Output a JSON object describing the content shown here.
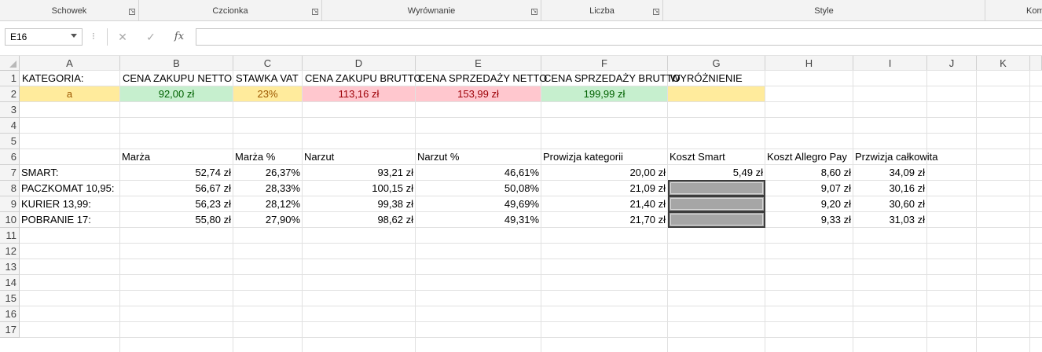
{
  "ribbon": {
    "groups": [
      "Schowek",
      "Czcionka",
      "Wyrównanie",
      "Liczba",
      "Style",
      "Kom"
    ]
  },
  "formula_bar": {
    "name_box": "E16",
    "dots": "⁝",
    "cancel": "✕",
    "enter": "✓",
    "fx": "fx",
    "formula": ""
  },
  "columns": [
    "A",
    "B",
    "C",
    "D",
    "E",
    "F",
    "G",
    "H",
    "I",
    "J",
    "K"
  ],
  "rows": [
    "1",
    "2",
    "3",
    "4",
    "5",
    "6",
    "7",
    "8",
    "9",
    "10",
    "11",
    "12",
    "13",
    "14",
    "15",
    "16",
    "17"
  ],
  "cells": {
    "A1": "KATEGORIA:",
    "B1": "CENA ZAKUPU NETTO",
    "C1": "STAWKA VAT",
    "D1": "CENA ZAKUPU BRUTTO",
    "E1": "CENA SPRZEDAŻY NETTO",
    "F1": "CENA SPRZEDAŻY BRUTTO",
    "G1": "WYRÓŻNIENIE",
    "A2": "a",
    "B2": "92,00 zł",
    "C2": "23%",
    "D2": "113,16 zł",
    "E2": "153,99 zł",
    "F2": "199,99 zł",
    "G2": "",
    "B6": "Marża",
    "C6": "Marża %",
    "D6": "Narzut",
    "E6": "Narzut %",
    "F6": "Prowizja kategorii",
    "G6": "Koszt Smart",
    "H6": "Koszt Allegro Pay",
    "I6": "Przwizja całkowita",
    "A7": "SMART:",
    "B7": "52,74 zł",
    "C7": "26,37%",
    "D7": "93,21 zł",
    "E7": "46,61%",
    "F7": "20,00 zł",
    "G7": "5,49 zł",
    "H7": "8,60 zł",
    "I7": "34,09 zł",
    "A8": "PACZKOMAT 10,95:",
    "B8": "56,67 zł",
    "C8": "28,33%",
    "D8": "100,15 zł",
    "E8": "50,08%",
    "F8": "21,09 zł",
    "H8": "9,07 zł",
    "I8": "30,16 zł",
    "A9": "KURIER 13,99:",
    "B9": "56,23 zł",
    "C9": "28,12%",
    "D9": "99,38 zł",
    "E9": "49,69%",
    "F9": "21,40 zł",
    "H9": "9,20 zł",
    "I9": "30,60 zł",
    "A10": "POBRANIE 17:",
    "B10": "55,80 zł",
    "C10": "27,90%",
    "D10": "98,62 zł",
    "E10": "49,31%",
    "F10": "21,70 zł",
    "H10": "9,33 zł",
    "I10": "31,03 zł"
  },
  "colors": {
    "yellow_fill": "#ffeb9c",
    "green_fill": "#c6efce",
    "red_fill": "#ffc7ce",
    "gray_fill": "#a6a6a6"
  }
}
